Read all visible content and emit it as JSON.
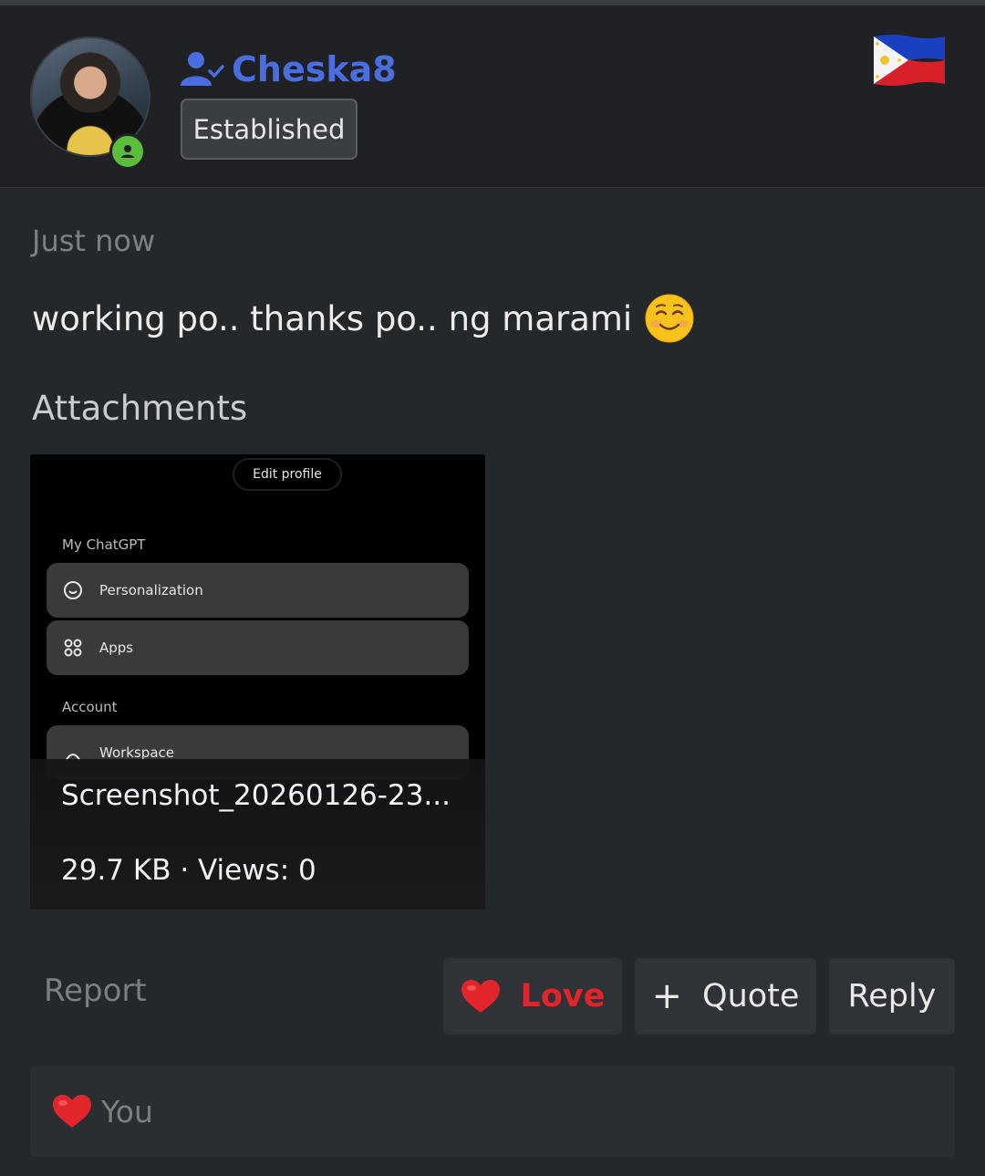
{
  "author": {
    "username": "Cheska8",
    "rank_badge": "Established",
    "online": true,
    "flag": "philippines-flag"
  },
  "post": {
    "timestamp": "Just now",
    "message": "working po.. thanks po.. ng marami",
    "emoji": "smiling-face-emoji"
  },
  "attachments": {
    "title": "Attachments",
    "items": [
      {
        "preview": {
          "edit_profile": "Edit profile",
          "section_my": "My ChatGPT",
          "personalization": "Personalization",
          "apps": "Apps",
          "section_account": "Account",
          "workspace": "Workspace"
        },
        "filename": "Screenshot_20260126-23...",
        "meta": "29.7 KB · Views: 0"
      }
    ]
  },
  "actions": {
    "report": "Report",
    "love": "Love",
    "quote": "Quote",
    "reply": "Reply"
  },
  "reactions": {
    "label": "You"
  },
  "colors": {
    "username": "#4a6ee0",
    "love": "#e2252b",
    "online": "#5bbd3b"
  }
}
